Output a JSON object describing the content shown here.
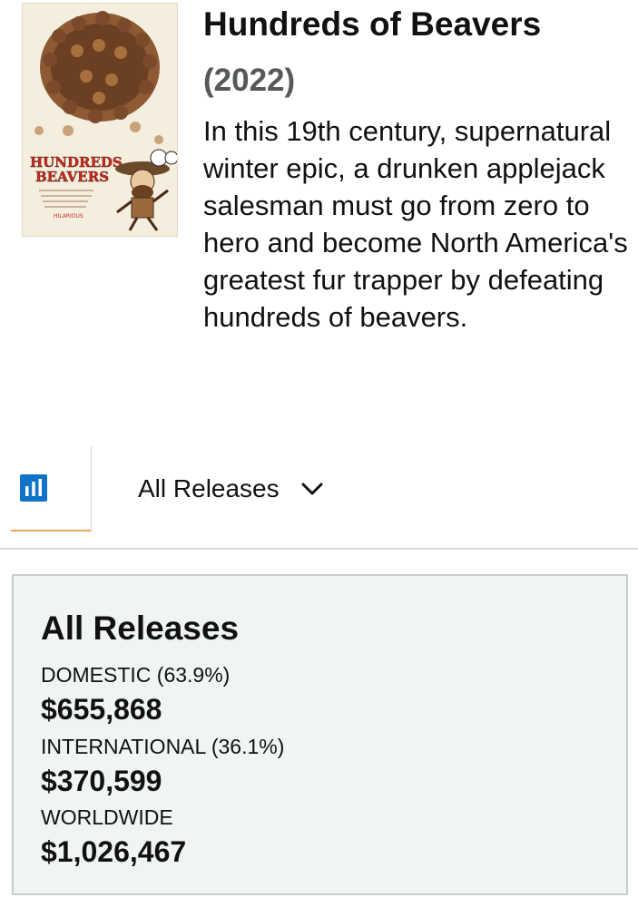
{
  "movie": {
    "title": "Hundreds of Beavers",
    "year": "(2022)",
    "summary": "In this 19th century, supernatural winter epic, a drunken applejack salesman must go from zero to hero and become North America's greatest fur trapper by defeating hundreds of beavers.",
    "poster": {
      "title_line_1": "HUNDREDS",
      "title_line_2": "BEAVERS",
      "tagline": "HILARIOUS"
    }
  },
  "tabs": {
    "chart_icon": "bar-chart-icon",
    "release_selector": "All Releases",
    "release_chevron_icon": "chevron-down-icon"
  },
  "box_office": {
    "heading": "All Releases",
    "domestic": {
      "label": "DOMESTIC (63.9%)",
      "value": "$655,868"
    },
    "international": {
      "label": "INTERNATIONAL (36.1%)",
      "value": "$370,599"
    },
    "worldwide": {
      "label": "WORLDWIDE",
      "value": "$1,026,467"
    }
  },
  "colors": {
    "accent_blue": "#0f73c7",
    "tab_underline": "#e7a563",
    "year_gray": "#565959",
    "card_background": "#f0f4f5"
  }
}
